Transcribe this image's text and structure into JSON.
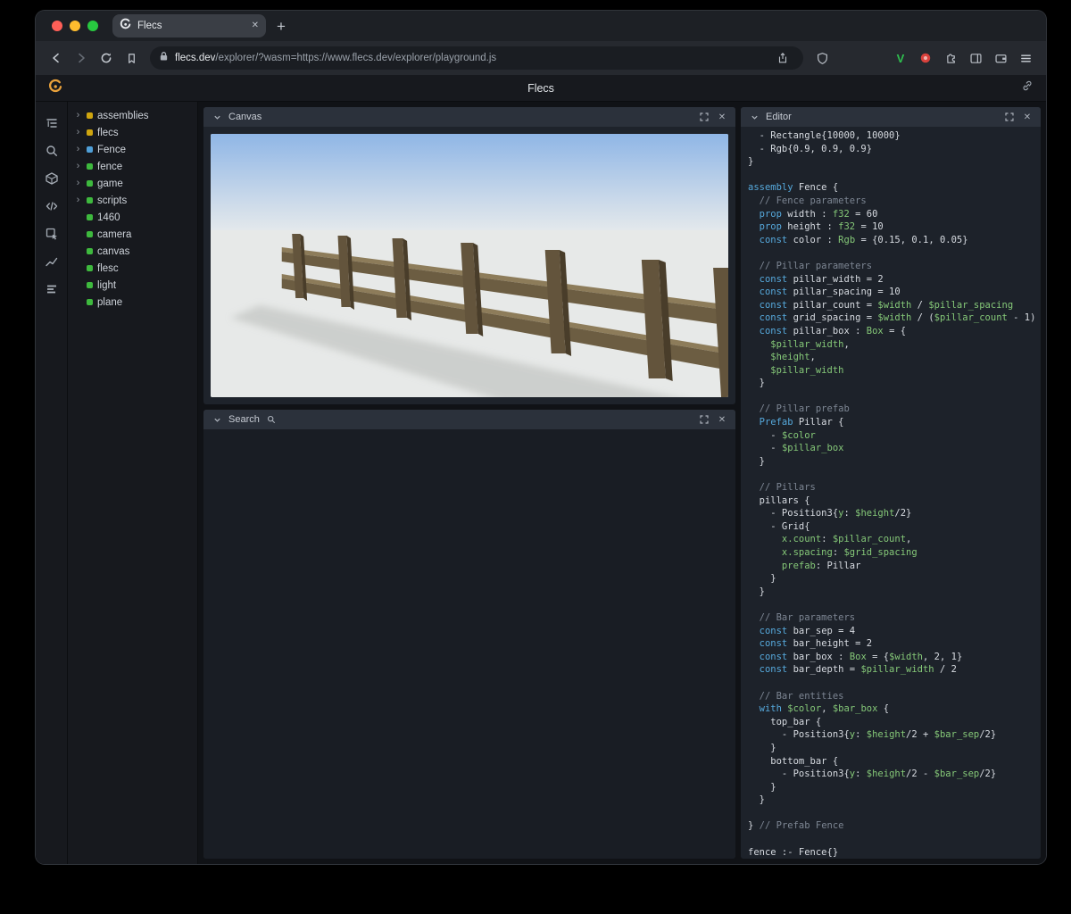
{
  "browser": {
    "tab": {
      "title": "Flecs"
    },
    "nav": {
      "url_domain": "flecs.dev",
      "url_path": "/explorer/?wasm=https://www.flecs.dev/explorer/playground.js"
    }
  },
  "app": {
    "title": "Flecs"
  },
  "rail": {
    "items": [
      "entity-tree-icon",
      "search-icon",
      "assets-cube-icon",
      "code-icon",
      "inspect-icon",
      "chart-icon",
      "stats-icon"
    ]
  },
  "tree": {
    "items": [
      {
        "label": "assemblies",
        "color": "#cfa50f",
        "expandable": true
      },
      {
        "label": "flecs",
        "color": "#cfa50f",
        "expandable": true
      },
      {
        "label": "Fence",
        "color": "#4f9fd8",
        "expandable": true
      },
      {
        "label": "fence",
        "color": "#3eb93e",
        "expandable": true
      },
      {
        "label": "game",
        "color": "#3eb93e",
        "expandable": true
      },
      {
        "label": "scripts",
        "color": "#3eb93e",
        "expandable": true
      },
      {
        "label": "1460",
        "color": "#3eb93e",
        "expandable": false
      },
      {
        "label": "camera",
        "color": "#3eb93e",
        "expandable": false
      },
      {
        "label": "canvas",
        "color": "#3eb93e",
        "expandable": false
      },
      {
        "label": "flesc",
        "color": "#3eb93e",
        "expandable": false
      },
      {
        "label": "light",
        "color": "#3eb93e",
        "expandable": false
      },
      {
        "label": "plane",
        "color": "#3eb93e",
        "expandable": false
      }
    ]
  },
  "canvas_panel": {
    "title": "Canvas"
  },
  "search_panel": {
    "title": "Search"
  },
  "editor_panel": {
    "title": "Editor"
  },
  "code": {
    "lines": [
      [
        [
          "p",
          "  - Rectangle{10000, 10000}"
        ]
      ],
      [
        [
          "p",
          "  - Rgb{0.9, 0.9, 0.9}"
        ]
      ],
      [
        [
          "p",
          "}"
        ]
      ],
      [],
      [
        [
          "k",
          "assembly"
        ],
        [
          "p",
          " Fence {"
        ]
      ],
      [
        [
          "c",
          "  // Fence parameters"
        ]
      ],
      [
        [
          "k",
          "  prop"
        ],
        [
          "p",
          " width : "
        ],
        [
          "v",
          "f32"
        ],
        [
          "p",
          " = 60"
        ]
      ],
      [
        [
          "k",
          "  prop"
        ],
        [
          "p",
          " height : "
        ],
        [
          "v",
          "f32"
        ],
        [
          "p",
          " = 10"
        ]
      ],
      [
        [
          "k",
          "  const"
        ],
        [
          "p",
          " color : "
        ],
        [
          "v",
          "Rgb"
        ],
        [
          "p",
          " = {0.15, 0.1, 0.05}"
        ]
      ],
      [],
      [
        [
          "c",
          "  // Pillar parameters"
        ]
      ],
      [
        [
          "k",
          "  const"
        ],
        [
          "p",
          " pillar_width = 2"
        ]
      ],
      [
        [
          "k",
          "  const"
        ],
        [
          "p",
          " pillar_spacing = 10"
        ]
      ],
      [
        [
          "k",
          "  const"
        ],
        [
          "p",
          " pillar_count = "
        ],
        [
          "v",
          "$width"
        ],
        [
          "p",
          " / "
        ],
        [
          "v",
          "$pillar_spacing"
        ]
      ],
      [
        [
          "k",
          "  const"
        ],
        [
          "p",
          " grid_spacing = "
        ],
        [
          "v",
          "$width"
        ],
        [
          "p",
          " / ("
        ],
        [
          "v",
          "$pillar_count"
        ],
        [
          "p",
          " - 1)"
        ]
      ],
      [
        [
          "k",
          "  const"
        ],
        [
          "p",
          " pillar_box : "
        ],
        [
          "v",
          "Box"
        ],
        [
          "p",
          " = {"
        ]
      ],
      [
        [
          "v",
          "    $pillar_width"
        ],
        [
          "p",
          ","
        ]
      ],
      [
        [
          "v",
          "    $height"
        ],
        [
          "p",
          ","
        ]
      ],
      [
        [
          "v",
          "    $pillar_width"
        ]
      ],
      [
        [
          "p",
          "  }"
        ]
      ],
      [],
      [
        [
          "c",
          "  // Pillar prefab"
        ]
      ],
      [
        [
          "k",
          "  Prefab"
        ],
        [
          "p",
          " Pillar {"
        ]
      ],
      [
        [
          "p",
          "    - "
        ],
        [
          "v",
          "$color"
        ]
      ],
      [
        [
          "p",
          "    - "
        ],
        [
          "v",
          "$pillar_box"
        ]
      ],
      [
        [
          "p",
          "  }"
        ]
      ],
      [],
      [
        [
          "c",
          "  // Pillars"
        ]
      ],
      [
        [
          "p",
          "  pillars {"
        ]
      ],
      [
        [
          "p",
          "    - Position3{"
        ],
        [
          "v",
          "y"
        ],
        [
          "p",
          ": "
        ],
        [
          "v",
          "$height"
        ],
        [
          "p",
          "/2}"
        ]
      ],
      [
        [
          "p",
          "    - Grid{"
        ]
      ],
      [
        [
          "v",
          "      x.count"
        ],
        [
          "p",
          ": "
        ],
        [
          "v",
          "$pillar_count"
        ],
        [
          "p",
          ","
        ]
      ],
      [
        [
          "v",
          "      x.spacing"
        ],
        [
          "p",
          ": "
        ],
        [
          "v",
          "$grid_spacing"
        ]
      ],
      [
        [
          "v",
          "      prefab"
        ],
        [
          "p",
          ": Pillar"
        ]
      ],
      [
        [
          "p",
          "    }"
        ]
      ],
      [
        [
          "p",
          "  }"
        ]
      ],
      [],
      [
        [
          "c",
          "  // Bar parameters"
        ]
      ],
      [
        [
          "k",
          "  const"
        ],
        [
          "p",
          " bar_sep = 4"
        ]
      ],
      [
        [
          "k",
          "  const"
        ],
        [
          "p",
          " bar_height = 2"
        ]
      ],
      [
        [
          "k",
          "  const"
        ],
        [
          "p",
          " bar_box : "
        ],
        [
          "v",
          "Box"
        ],
        [
          "p",
          " = {"
        ],
        [
          "v",
          "$width"
        ],
        [
          "p",
          ", 2, 1}"
        ]
      ],
      [
        [
          "k",
          "  const"
        ],
        [
          "p",
          " bar_depth = "
        ],
        [
          "v",
          "$pillar_width"
        ],
        [
          "p",
          " / 2"
        ]
      ],
      [],
      [
        [
          "c",
          "  // Bar entities"
        ]
      ],
      [
        [
          "k",
          "  with"
        ],
        [
          "p",
          " "
        ],
        [
          "v",
          "$color"
        ],
        [
          "p",
          ", "
        ],
        [
          "v",
          "$bar_box"
        ],
        [
          "p",
          " {"
        ]
      ],
      [
        [
          "p",
          "    top_bar {"
        ]
      ],
      [
        [
          "p",
          "      - Position3{"
        ],
        [
          "v",
          "y"
        ],
        [
          "p",
          ": "
        ],
        [
          "v",
          "$height"
        ],
        [
          "p",
          "/2 + "
        ],
        [
          "v",
          "$bar_sep"
        ],
        [
          "p",
          "/2}"
        ]
      ],
      [
        [
          "p",
          "    }"
        ]
      ],
      [
        [
          "p",
          "    bottom_bar {"
        ]
      ],
      [
        [
          "p",
          "      - Position3{"
        ],
        [
          "v",
          "y"
        ],
        [
          "p",
          ": "
        ],
        [
          "v",
          "$height"
        ],
        [
          "p",
          "/2 - "
        ],
        [
          "v",
          "$bar_sep"
        ],
        [
          "p",
          "/2}"
        ]
      ],
      [
        [
          "p",
          "    }"
        ]
      ],
      [
        [
          "p",
          "  }"
        ]
      ],
      [],
      [
        [
          "p",
          "} "
        ],
        [
          "c",
          "// Prefab Fence"
        ]
      ],
      [],
      [
        [
          "p",
          "fence :- Fence{}"
        ]
      ]
    ]
  }
}
